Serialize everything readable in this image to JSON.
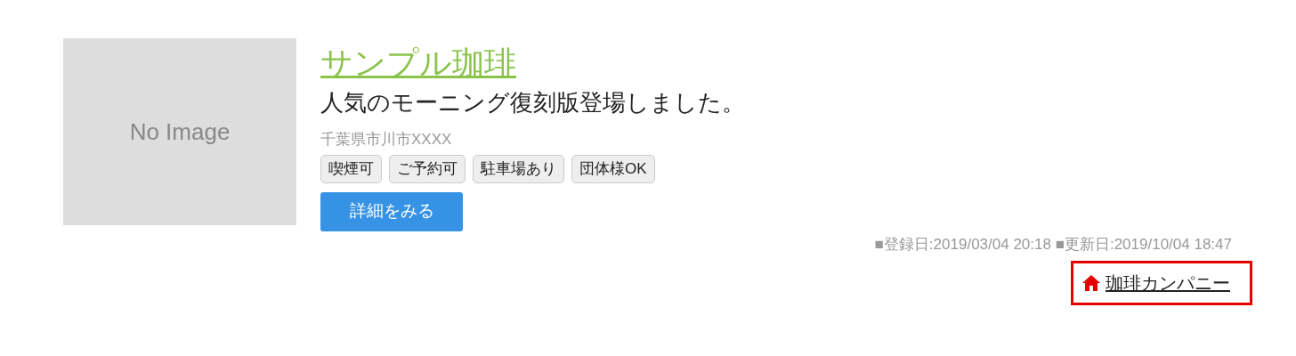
{
  "image": {
    "label": "No Image"
  },
  "title": "サンプル珈琲",
  "catchphrase": "人気のモーニング復刻版登場しました。",
  "address": "千葉県市川市XXXX",
  "tags": [
    "喫煙可",
    "ご予約可",
    "駐車場あり",
    "団体様OK"
  ],
  "detail_button": "詳細をみる",
  "dates": "■登録日:2019/03/04 20:18 ■更新日:2019/10/04 18:47",
  "company_link": {
    "label": "珈琲カンパニー",
    "highlighted": true
  }
}
